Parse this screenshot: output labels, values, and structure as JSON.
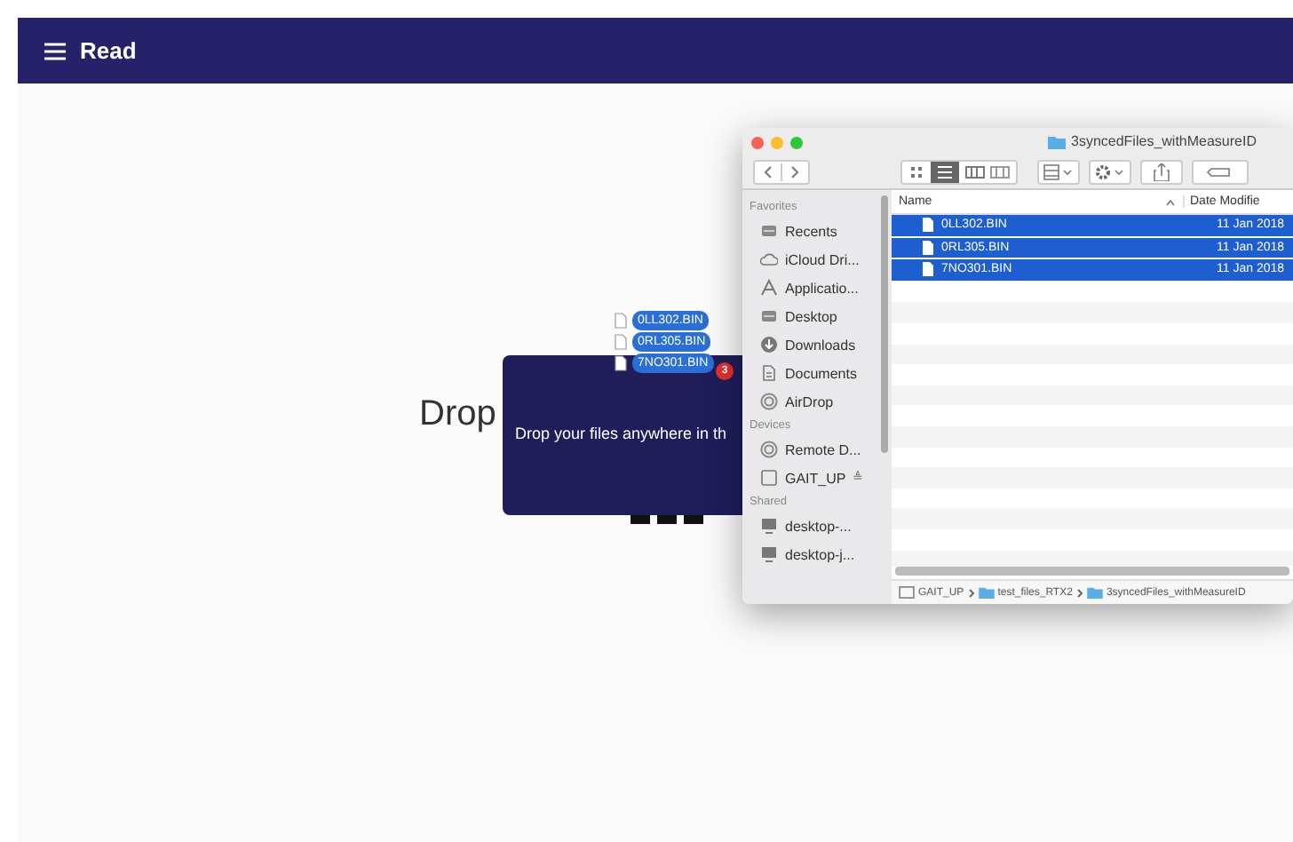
{
  "app_bar": {
    "title": "Read"
  },
  "page": {
    "heading": "Drop"
  },
  "drop_overlay": {
    "message": "Drop your files anywhere in th"
  },
  "drag_items": [
    {
      "name": "0LL302.BIN"
    },
    {
      "name": "0RL305.BIN"
    },
    {
      "name": "7NO301.BIN"
    }
  ],
  "drag_count": "3",
  "finder": {
    "title": "3syncedFiles_withMeasureID",
    "sidebar": [
      {
        "section": "Favorites",
        "items": [
          {
            "label": "Recents",
            "kind": "recents"
          },
          {
            "label": "iCloud Dri...",
            "kind": "cloud"
          },
          {
            "label": "Applicatio...",
            "kind": "apps"
          },
          {
            "label": "Desktop",
            "kind": "desktop"
          },
          {
            "label": "Downloads",
            "kind": "downloads"
          },
          {
            "label": "Documents",
            "kind": "documents"
          },
          {
            "label": "AirDrop",
            "kind": "airdrop"
          }
        ]
      },
      {
        "section": "Devices",
        "items": [
          {
            "label": "Remote D...",
            "kind": "disc"
          },
          {
            "label": "GAIT_UP",
            "kind": "drive",
            "eject": "≜"
          }
        ]
      },
      {
        "section": "Shared",
        "items": [
          {
            "label": "desktop-...",
            "kind": "computer"
          },
          {
            "label": "desktop-j...",
            "kind": "computer"
          }
        ]
      }
    ],
    "columns": [
      "Name",
      "Date Modifie"
    ],
    "files": [
      {
        "name": "0LL302.BIN",
        "date": "11 Jan 2018",
        "selected": true
      },
      {
        "name": "0RL305.BIN",
        "date": "11 Jan 2018",
        "selected": true
      },
      {
        "name": "7NO301.BIN",
        "date": "11 Jan 2018",
        "selected": true
      }
    ],
    "path": [
      "GAIT_UP",
      "test_files_RTX2",
      "3syncedFiles_withMeasureID"
    ]
  }
}
